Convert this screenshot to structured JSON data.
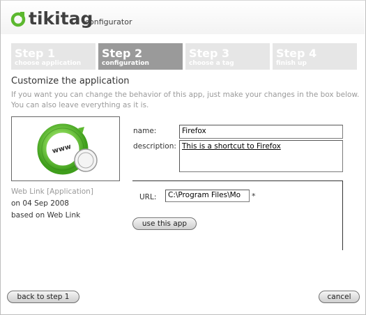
{
  "header": {
    "logo_text": "tikitag",
    "logo_subtitle": "configurator",
    "brand_color": "#5cb82f"
  },
  "steps": [
    {
      "title": "Step 1",
      "subtitle": "choose application",
      "state": "inactive"
    },
    {
      "title": "Step 2",
      "subtitle": "configuration",
      "state": "active"
    },
    {
      "title": "Step 3",
      "subtitle": "choose a tag",
      "state": "inactive"
    },
    {
      "title": "Step 4",
      "subtitle": "finish up",
      "state": "inactive"
    }
  ],
  "main": {
    "title": "Customize the application",
    "intro": "If you want you can change the behavior of this app, just make your changes in the box below. You can also leave everything as it is."
  },
  "app_info": {
    "name": "Web Link [Application]",
    "date": "on 04 Sep 2008",
    "based_on": "based on Web Link",
    "preview_icon": "www-globe-icon"
  },
  "form": {
    "name_label": "name:",
    "name_value": "Firefox",
    "description_label": "description:",
    "description_value": "This is a shortcut to Firefox",
    "url_label": "URL:",
    "url_value": "C:\\Program Files\\Mo",
    "url_required_marker": "*",
    "use_button": "use this app"
  },
  "footer": {
    "back_button": "back to step 1",
    "cancel_button": "cancel"
  },
  "colors": {
    "step_active": "#9a9a9a",
    "step_inactive": "#e6e6e6",
    "accent_green": "#5cb82f"
  }
}
